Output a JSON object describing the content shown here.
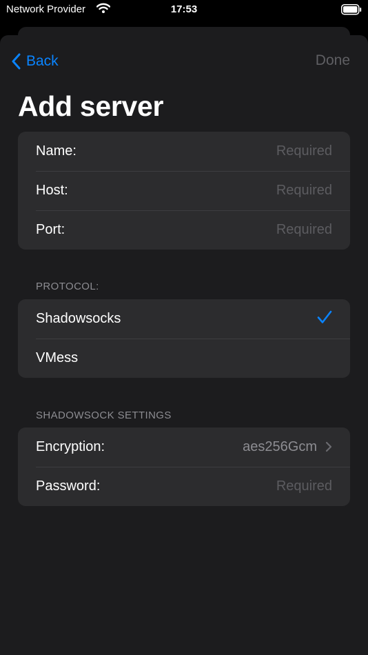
{
  "status_bar": {
    "carrier": "Network Provider",
    "time": "17:53"
  },
  "nav": {
    "back_label": "Back",
    "done_label": "Done"
  },
  "title": "Add server",
  "server_fields": [
    {
      "label": "Name:",
      "placeholder": "Required"
    },
    {
      "label": "Host:",
      "placeholder": "Required"
    },
    {
      "label": "Port:",
      "placeholder": "Required"
    }
  ],
  "protocol": {
    "header": "PROTOCOL:",
    "options": [
      {
        "label": "Shadowsocks",
        "selected": true
      },
      {
        "label": "VMess",
        "selected": false
      }
    ]
  },
  "shadowsocks_settings": {
    "header": "SHADOWSOCK SETTINGS",
    "encryption_label": "Encryption:",
    "encryption_value": "aes256Gcm",
    "password_label": "Password:",
    "password_placeholder": "Required"
  },
  "colors": {
    "accent": "#0a84ff",
    "background": "#1c1c1e",
    "group_background": "#2c2c2e",
    "placeholder": "#5c5c60",
    "secondary_text": "#8d8d92"
  },
  "icons": {
    "back": "chevron-left-icon",
    "selected": "checkmark-icon",
    "disclosure": "chevron-right-icon",
    "wifi": "wifi-icon",
    "battery": "battery-icon"
  }
}
